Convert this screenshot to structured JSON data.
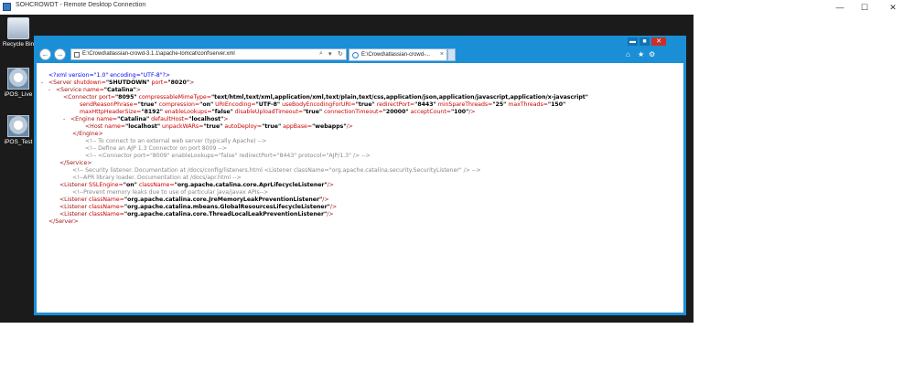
{
  "rdp": {
    "title": "SOHCROWDT - Remote Desktop Connection",
    "controls": {
      "minimize": "—",
      "maximize": "☐",
      "close": "✕"
    }
  },
  "desktop": {
    "icons": [
      {
        "label": "Recycle Bin",
        "icon": "recycle-bin-icon"
      },
      {
        "label": "iPOS_Live",
        "icon": "computer-icon"
      },
      {
        "label": "iPOS_Test",
        "icon": "computer-icon"
      }
    ]
  },
  "browser": {
    "window_controls": {
      "minimize": "▬",
      "maximize": "■",
      "close": "✕"
    },
    "address": "E:\\Crowd\\atlassian-crowd-3.1.1\\apache-tomcat\\conf\\server.xml",
    "address_tools": {
      "search": "⌕",
      "dropdown": "▾",
      "refresh": "↻"
    },
    "tab_title": "E:\\Crowd\\atlassian-crowd-...",
    "tab_close": "×",
    "toolbar": {
      "home": "⌂",
      "favorites": "★",
      "settings": "⚙"
    }
  },
  "xml": {
    "decl": "<?xml version=\"1.0\" encoding=\"UTF-8\"?>",
    "server_open": {
      "tag": "<Server",
      "attr": " shutdown=",
      "val": "\"SHUTDOWN\"",
      "attr2": " port=",
      "val2": "\"8020\"",
      "end": ">"
    },
    "service_open": {
      "tag": "<Service",
      "attr": " name=",
      "val": "\"Catalina\"",
      "end": ">"
    },
    "connector": {
      "l1_tag": "<Connector",
      "l1_a1": " port=",
      "l1_v1": "\"8095\"",
      "l1_a2": " compressableMimeType=",
      "l1_v2": "\"text/html,text/xml,application/xml,text/plain,text/css,application/json,application/javascript,application/x-javascript\"",
      "l2_a1": "sendReasonPhrase=",
      "l2_v1": "\"true\"",
      "l2_a2": " compression=",
      "l2_v2": "\"on\"",
      "l2_a3": " URIEncoding=",
      "l2_v3": "\"UTF-8\"",
      "l2_a4": " useBodyEncodingForURI=",
      "l2_v4": "\"true\"",
      "l2_a5": " redirectPort=",
      "l2_v5": "\"8443\"",
      "l2_a6": " minSpareThreads=",
      "l2_v6": "\"25\"",
      "l2_a7": " maxThreads=",
      "l2_v7": "\"150\"",
      "l3_a1": "maxHttpHeaderSize=",
      "l3_v1": "\"8192\"",
      "l3_a2": " enableLookups=",
      "l3_v2": "\"false\"",
      "l3_a3": " disableUploadTimeout=",
      "l3_v3": "\"true\"",
      "l3_a4": " connectionTimeout=",
      "l3_v4": "\"20000\"",
      "l3_a5": " acceptCount=",
      "l3_v5": "\"100\"",
      "l3_end": "/>"
    },
    "engine_open": {
      "tag": "<Engine",
      "attr": " name=",
      "val": "\"Catalina\"",
      "attr2": " defaultHost=",
      "val2": "\"localhost\"",
      "end": ">"
    },
    "host": {
      "tag": "<Host",
      "a1": " name=",
      "v1": "\"localhost\"",
      "a2": " unpackWARs=",
      "v2": "\"true\"",
      "a3": " autoDeploy=",
      "v3": "\"true\"",
      "a4": " appBase=",
      "v4": "\"webapps\"",
      "end": "/>"
    },
    "engine_close": "</Engine>",
    "comment1": "<!-- To connect to an external web server (typically Apache) -->",
    "comment2": "<!-- Define an AJP 1.3 Connector on port 8009 -->",
    "comment3": "<!-- <Connector port=\"8009\" enableLookups=\"false\" redirectPort=\"8443\" protocol=\"AJP/1.3\" /> -->",
    "service_close": "</Service>",
    "comment4": "<!-- Security listener. Documentation at /docs/config/listeners.html <Listener className=\"org.apache.catalina.security.SecurityListener\" /> -->",
    "comment5": "<!--APR library loader. Documentation at /docs/apr.html -->",
    "listener1": {
      "tag": "<Listener",
      "a1": " SSLEngine=",
      "v1": "\"on\"",
      "a2": " className=",
      "v2": "\"org.apache.catalina.core.AprLifecycleListener\"",
      "end": "/>"
    },
    "comment6": "<!--Prevent memory leaks due to use of particular java/javax APIs-->",
    "listener2": {
      "tag": "<Listener",
      "a1": " className=",
      "v1": "\"org.apache.catalina.core.JreMemoryLeakPreventionListener\"",
      "end": "/>"
    },
    "listener3": {
      "tag": "<Listener",
      "a1": " className=",
      "v1": "\"org.apache.catalina.mbeans.GlobalResourcesLifecycleListener\"",
      "end": "/>"
    },
    "listener4": {
      "tag": "<Listener",
      "a1": " className=",
      "v1": "\"org.apache.catalina.core.ThreadLocalLeakPreventionListener\"",
      "end": "/>"
    },
    "server_close": "</Server>",
    "expander": "-"
  }
}
